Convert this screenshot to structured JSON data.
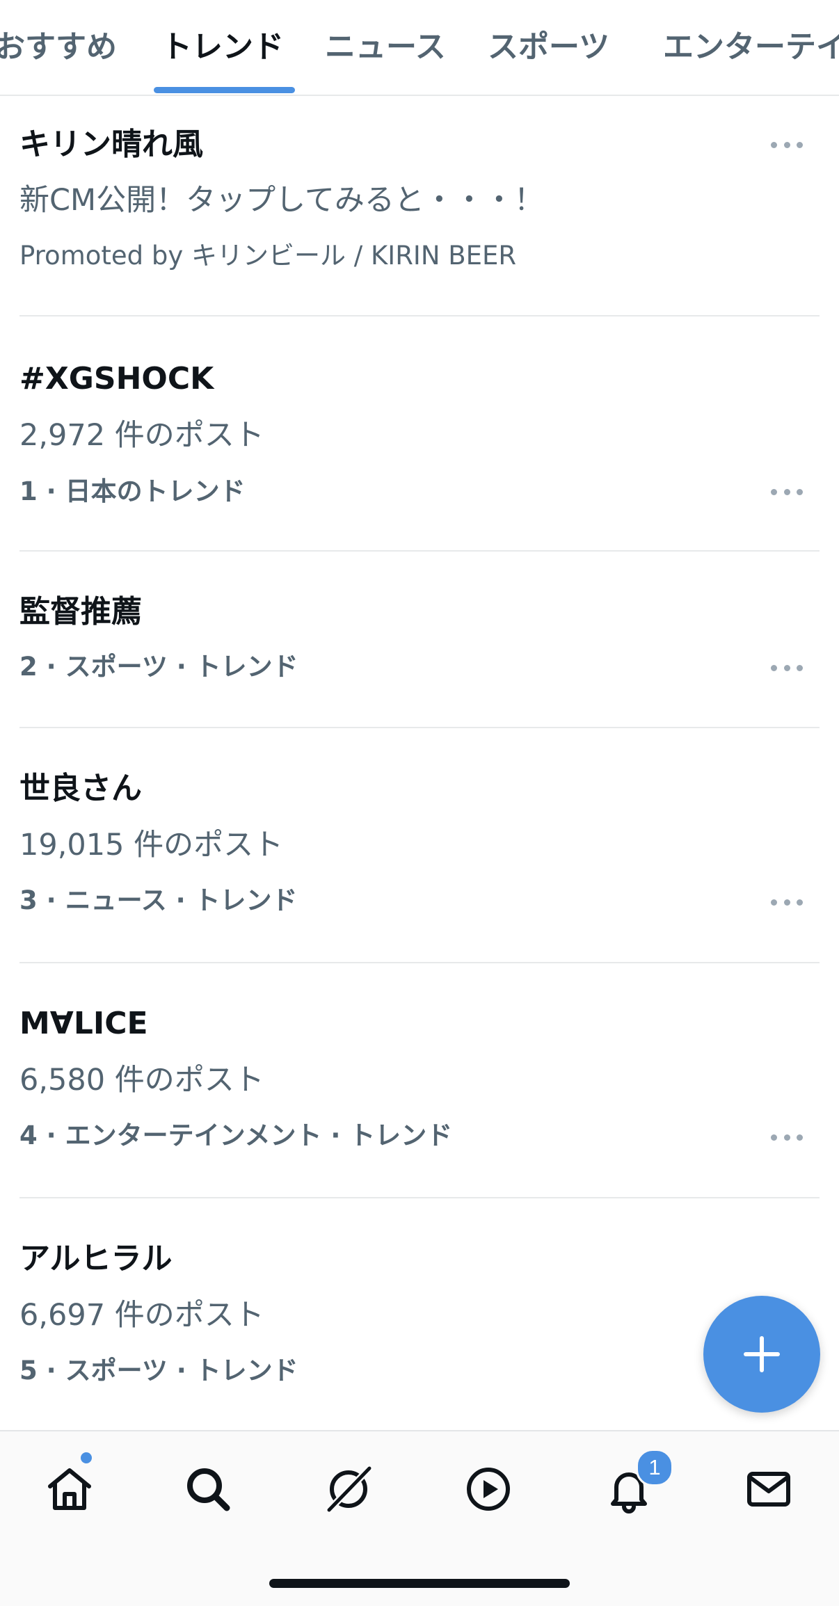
{
  "tabs": [
    {
      "label": "おすすめ",
      "active": false
    },
    {
      "label": "トレンド",
      "active": true
    },
    {
      "label": "ニュース",
      "active": false
    },
    {
      "label": "スポーツ",
      "active": false
    },
    {
      "label": "エンターテイ",
      "active": false
    }
  ],
  "promoted": {
    "title": "キリン晴れ風",
    "description": "新CM公開！タップしてみると・・・！",
    "promoted_by": "Promoted by キリンビール / KIRIN BEER"
  },
  "trends": [
    {
      "title": "#XGSHOCK",
      "posts": "2,972 件のポスト",
      "meta": "1 · 日本のトレンド"
    },
    {
      "title": "監督推薦",
      "posts": "",
      "meta": "2 · スポーツ · トレンド"
    },
    {
      "title": "世良さん",
      "posts": "19,015 件のポスト",
      "meta": "3 · ニュース · トレンド"
    },
    {
      "title": "M∀LICE",
      "posts": "6,580 件のポスト",
      "meta": "4 · エンターテインメント · トレンド"
    },
    {
      "title": "アルヒラル",
      "posts": "6,697 件のポスト",
      "meta": "5 · スポーツ · トレンド"
    }
  ],
  "bottom_nav": {
    "items": [
      "home-icon",
      "search-icon",
      "grok-icon",
      "video-icon",
      "notifications-icon",
      "messages-icon"
    ],
    "notification_count": "1"
  },
  "colors": {
    "accent": "#4a90e2",
    "text": "#0f1419",
    "secondary": "#536471",
    "divider": "#e7e9ea"
  }
}
